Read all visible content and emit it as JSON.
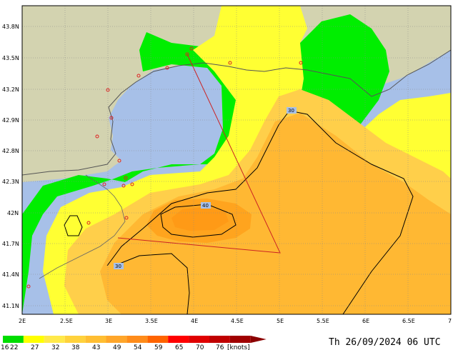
{
  "map": {
    "lat_ticks": [
      "43.8N",
      "43.5N",
      "43.2N",
      "42.9N",
      "42.8N",
      "42.3N",
      "42N",
      "41.7N",
      "41.4N",
      "41.1N"
    ],
    "lon_ticks": [
      "2E",
      "2.5E",
      "3E",
      "3.5E",
      "4E",
      "4.5E",
      "5E",
      "5.5E",
      "6E",
      "6.5E",
      "7"
    ],
    "contour_labels": [
      "30",
      "40",
      "30"
    ],
    "timestamp": "Th 26/09/2024 06 UTC"
  },
  "colorbar": {
    "labels": [
      "16",
      "22",
      "27",
      "32",
      "38",
      "43",
      "49",
      "54",
      "59",
      "65",
      "70",
      "76",
      "[knots]"
    ],
    "colors": [
      "#00dd00",
      "#ffff00",
      "#ffe94a",
      "#ffd23c",
      "#ffbe32",
      "#ffa62a",
      "#ff8c1a",
      "#ff6400",
      "#ff0000",
      "#e00000",
      "#c00000",
      "#a00000"
    ]
  },
  "colors": {
    "land": "#d3d3b0",
    "sea": "#a7c0e8",
    "green": "#00ee00",
    "yellow": "#ffff33",
    "orange_light": "#ffc24a",
    "orange_mid": "#ffaa2a",
    "orange_dark": "#ff9c10",
    "triangle": "#cc2222"
  }
}
